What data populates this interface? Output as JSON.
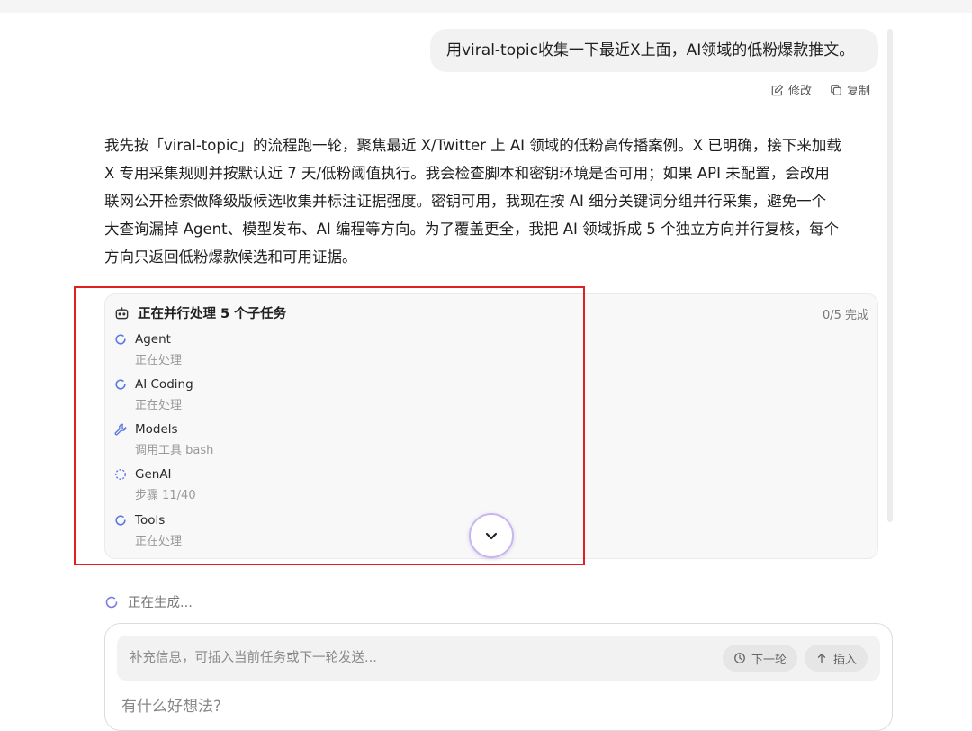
{
  "user_message": {
    "text": "用viral-topic收集一下最近X上面，AI领域的低粉爆款推文。",
    "actions": [
      {
        "label": "修改",
        "icon": "edit-icon"
      },
      {
        "label": "复制",
        "icon": "copy-icon"
      }
    ]
  },
  "assistant": {
    "lines": [
      "我先按「viral-topic」的流程跑一轮，聚焦最近 X/Twitter 上 AI 领域的低粉高传播案例。X 已明确，接下来加载",
      "X 专用采集规则并按默认近 7 天/低粉阈值执行。我会检查脚本和密钥环境是否可用；如果 API 未配置，会改用",
      "联网公开检索做降级版候选收集并标注证据强度。密钥可用，我现在按 AI 细分关键词分组并行采集，避免一个",
      "大查询漏掉 Agent、模型发布、AI 编程等方向。为了覆盖更全，我把 AI 领域拆成 5 个独立方向并行复核，每个",
      "方向只返回低粉爆款候选和可用证据。"
    ]
  },
  "task_panel": {
    "title": "正在并行处理 5 个子任务",
    "progress": "0/5 完成",
    "subtasks": [
      {
        "name": "Agent",
        "status": "正在处理",
        "icon": "spinner-icon"
      },
      {
        "name": "AI Coding",
        "status": "正在处理",
        "icon": "spinner-icon"
      },
      {
        "name": "Models",
        "status": "调用工具 bash",
        "icon": "wrench-icon"
      },
      {
        "name": "GenAI",
        "status": "步骤 11/40",
        "icon": "dashed-circle-icon"
      },
      {
        "name": "Tools",
        "status": "正在处理",
        "icon": "spinner-icon"
      }
    ]
  },
  "generating_text": "正在生成...",
  "composer": {
    "followup_placeholder": "补充信息，可插入当前任务或下一轮发送...",
    "next_round_label": "下一轮",
    "insert_label": "插入",
    "main_placeholder": "有什么好想法?"
  },
  "colors": {
    "accent_spinner": "#5b7be0",
    "highlight_box": "#e02020",
    "scroll_button_border": "#c8b6ef"
  }
}
